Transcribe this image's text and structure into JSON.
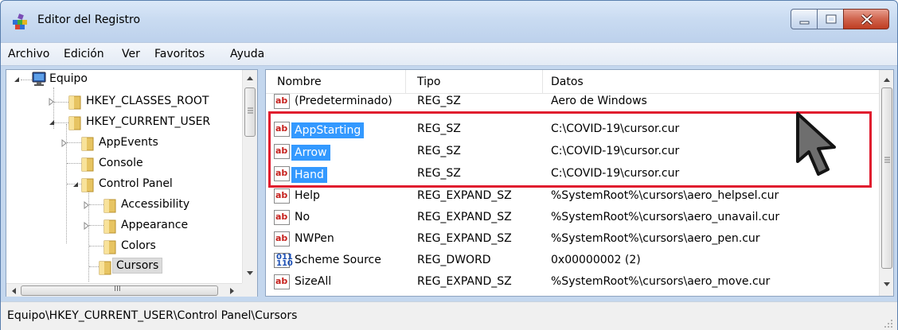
{
  "window": {
    "title": "Editor del Registro"
  },
  "menubar": {
    "items": [
      "Archivo",
      "Edición",
      "Ver",
      "Favoritos",
      "Ayuda"
    ]
  },
  "tree": {
    "root": "Equipo",
    "nodes": [
      "HKEY_CLASSES_ROOT",
      "HKEY_CURRENT_USER",
      "AppEvents",
      "Console",
      "Control Panel",
      "Accessibility",
      "Appearance",
      "Colors",
      "Cursors"
    ],
    "selected": "Cursors",
    "hscroll_glyph": "III"
  },
  "list": {
    "columns": [
      "Nombre",
      "Tipo",
      "Datos"
    ],
    "rows": [
      {
        "name": "(Predeterminado)",
        "type": "REG_SZ",
        "data": "Aero de Windows",
        "icon": "string-value-icon"
      },
      {
        "name": "AppStarting",
        "type": "REG_SZ",
        "data": "C:\\COVID-19\\cursor.cur",
        "icon": "string-value-icon",
        "selected": true
      },
      {
        "name": "Arrow",
        "type": "REG_SZ",
        "data": "C:\\COVID-19\\cursor.cur",
        "icon": "string-value-icon",
        "selected": true
      },
      {
        "name": "Hand",
        "type": "REG_SZ",
        "data": "C:\\COVID-19\\cursor.cur",
        "icon": "string-value-icon",
        "selected": true
      },
      {
        "name": "Help",
        "type": "REG_EXPAND_SZ",
        "data": "%SystemRoot%\\cursors\\aero_helpsel.cur",
        "icon": "string-value-icon"
      },
      {
        "name": "No",
        "type": "REG_EXPAND_SZ",
        "data": "%SystemRoot%\\cursors\\aero_unavail.cur",
        "icon": "string-value-icon"
      },
      {
        "name": "NWPen",
        "type": "REG_EXPAND_SZ",
        "data": "%SystemRoot%\\cursors\\aero_pen.cur",
        "icon": "string-value-icon"
      },
      {
        "name": "Scheme Source",
        "type": "REG_DWORD",
        "data": "0x00000002 (2)",
        "icon": "dword-value-icon"
      },
      {
        "name": "SizeAll",
        "type": "REG_EXPAND_SZ",
        "data": "%SystemRoot%\\cursors\\aero_move.cur",
        "icon": "string-value-icon"
      }
    ]
  },
  "icons": {
    "string_glyph": "ab",
    "dword_glyph": "011\n110"
  },
  "statusbar": {
    "path": "Equipo\\HKEY_CURRENT_USER\\Control Panel\\Cursors"
  },
  "colors": {
    "selection": "#3399ff",
    "highlight_box": "#e01b2e",
    "titlebar": "#c9dbf1"
  }
}
